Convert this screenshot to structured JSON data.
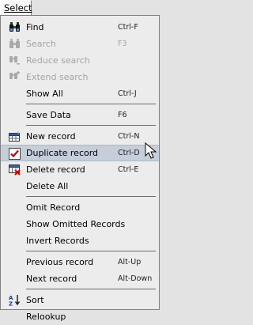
{
  "menubar": {
    "title": "Select"
  },
  "menu": {
    "items": [
      {
        "label": "Find",
        "shortcut": "Ctrl-F",
        "enabled": true,
        "icon": "binoculars-icon"
      },
      {
        "label": "Search",
        "shortcut": "F3",
        "enabled": false,
        "icon": "binoculars-icon"
      },
      {
        "label": "Reduce search",
        "shortcut": "",
        "enabled": false,
        "icon": "binoculars-minus-icon"
      },
      {
        "label": "Extend search",
        "shortcut": "",
        "enabled": false,
        "icon": "binoculars-plus-icon"
      },
      {
        "label": "Show All",
        "shortcut": "Ctrl-J",
        "enabled": true
      },
      {
        "label": "Save Data",
        "shortcut": "F6",
        "enabled": true
      },
      {
        "label": "New record",
        "shortcut": "Ctrl-N",
        "enabled": true,
        "icon": "new-record-icon"
      },
      {
        "label": "Duplicate record",
        "shortcut": "Ctrl-D",
        "enabled": true,
        "selected": true,
        "icon": "duplicate-check-icon"
      },
      {
        "label": "Delete record",
        "shortcut": "Ctrl-E",
        "enabled": true,
        "icon": "delete-record-icon"
      },
      {
        "label": "Delete All",
        "shortcut": "",
        "enabled": true
      },
      {
        "label": "Omit Record",
        "shortcut": "",
        "enabled": true
      },
      {
        "label": "Show Omitted Records",
        "shortcut": "",
        "enabled": true
      },
      {
        "label": "Invert Records",
        "shortcut": "",
        "enabled": true
      },
      {
        "label": "Previous record",
        "shortcut": "Alt-Up",
        "enabled": true
      },
      {
        "label": "Next record",
        "shortcut": "Alt-Down",
        "enabled": true
      },
      {
        "label": "Sort",
        "shortcut": "",
        "enabled": true,
        "icon": "sort-az-icon"
      },
      {
        "label": "Relookup",
        "shortcut": "",
        "enabled": true
      }
    ]
  },
  "colors": {
    "menu_bg": "#ececec",
    "highlight": "#c5ced9",
    "disabled_text": "#a4a4a4",
    "separator": "#6d6d6d"
  }
}
